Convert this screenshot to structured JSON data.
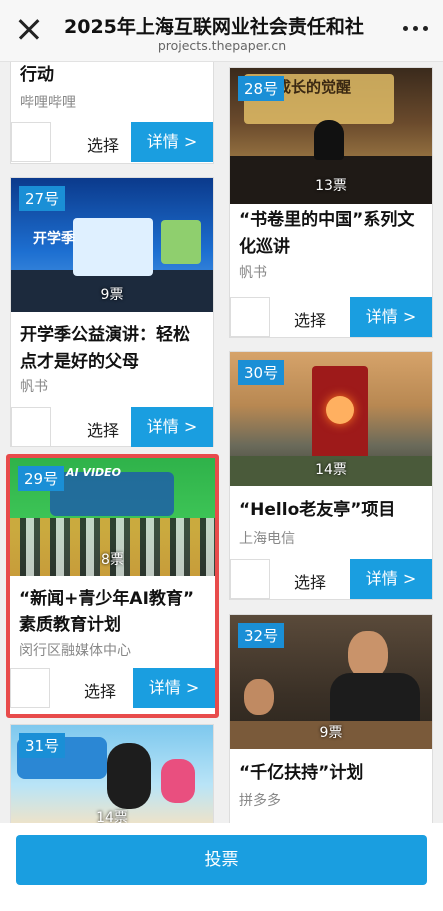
{
  "header": {
    "title": "2025年上海互联网业社会责任和社",
    "subtitle": "projects.thepaper.cn",
    "close_icon": "close-icon",
    "more_icon": "more-icon"
  },
  "cards": {
    "bilibili": {
      "title_line2": "行动",
      "org": "哔哩哔哩",
      "select": "选择",
      "detail": "详情 >"
    },
    "c27": {
      "number": "27号",
      "votes": "9票",
      "title_line1": "开学季公益演讲：轻松",
      "title_line2": "点才是好的父母",
      "org": "帆书",
      "select": "选择",
      "detail": "详情 >",
      "image_text": "开学季"
    },
    "c29": {
      "number": "29号",
      "votes": "8票",
      "title_line1": "“新闻+青少年AI教育”",
      "title_line2": "素质教育计划",
      "org": "闵行区融媒体中心",
      "select": "选择",
      "detail": "详情 >",
      "image_text": "AI VIDEO"
    },
    "c31": {
      "number": "31号",
      "votes": "14票"
    },
    "c28": {
      "number": "28号",
      "votes": "13票",
      "title_line1": "“书卷里的中国”系列文",
      "title_line2": "化巡讲",
      "org": "帆书",
      "select": "选择",
      "detail": "详情 >",
      "image_text": "成长的觉醒"
    },
    "c30": {
      "number": "30号",
      "votes": "14票",
      "title_line1": "“Hello老友亭”项目",
      "org": "上海电信",
      "select": "选择",
      "detail": "详情 >"
    },
    "c32": {
      "number": "32号",
      "votes": "9票",
      "title_line1": "“千亿扶持”计划",
      "org": "拼多多"
    }
  },
  "footer": {
    "vote_label": "投票"
  },
  "colors": {
    "accent": "#1a9ee0",
    "selected_border": "#e84b4b"
  }
}
